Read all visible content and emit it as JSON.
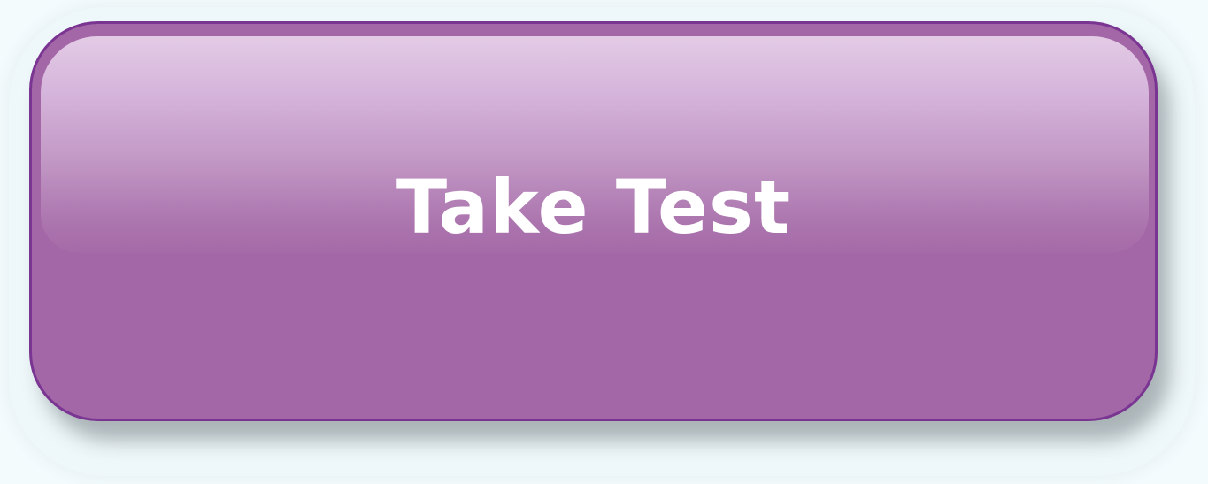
{
  "button": {
    "label": "Take Test",
    "fill_color": "#a366a6",
    "border_color": "#7a3592",
    "gloss_top_color": "#e3cbe5",
    "text_color": "#ffffff"
  }
}
